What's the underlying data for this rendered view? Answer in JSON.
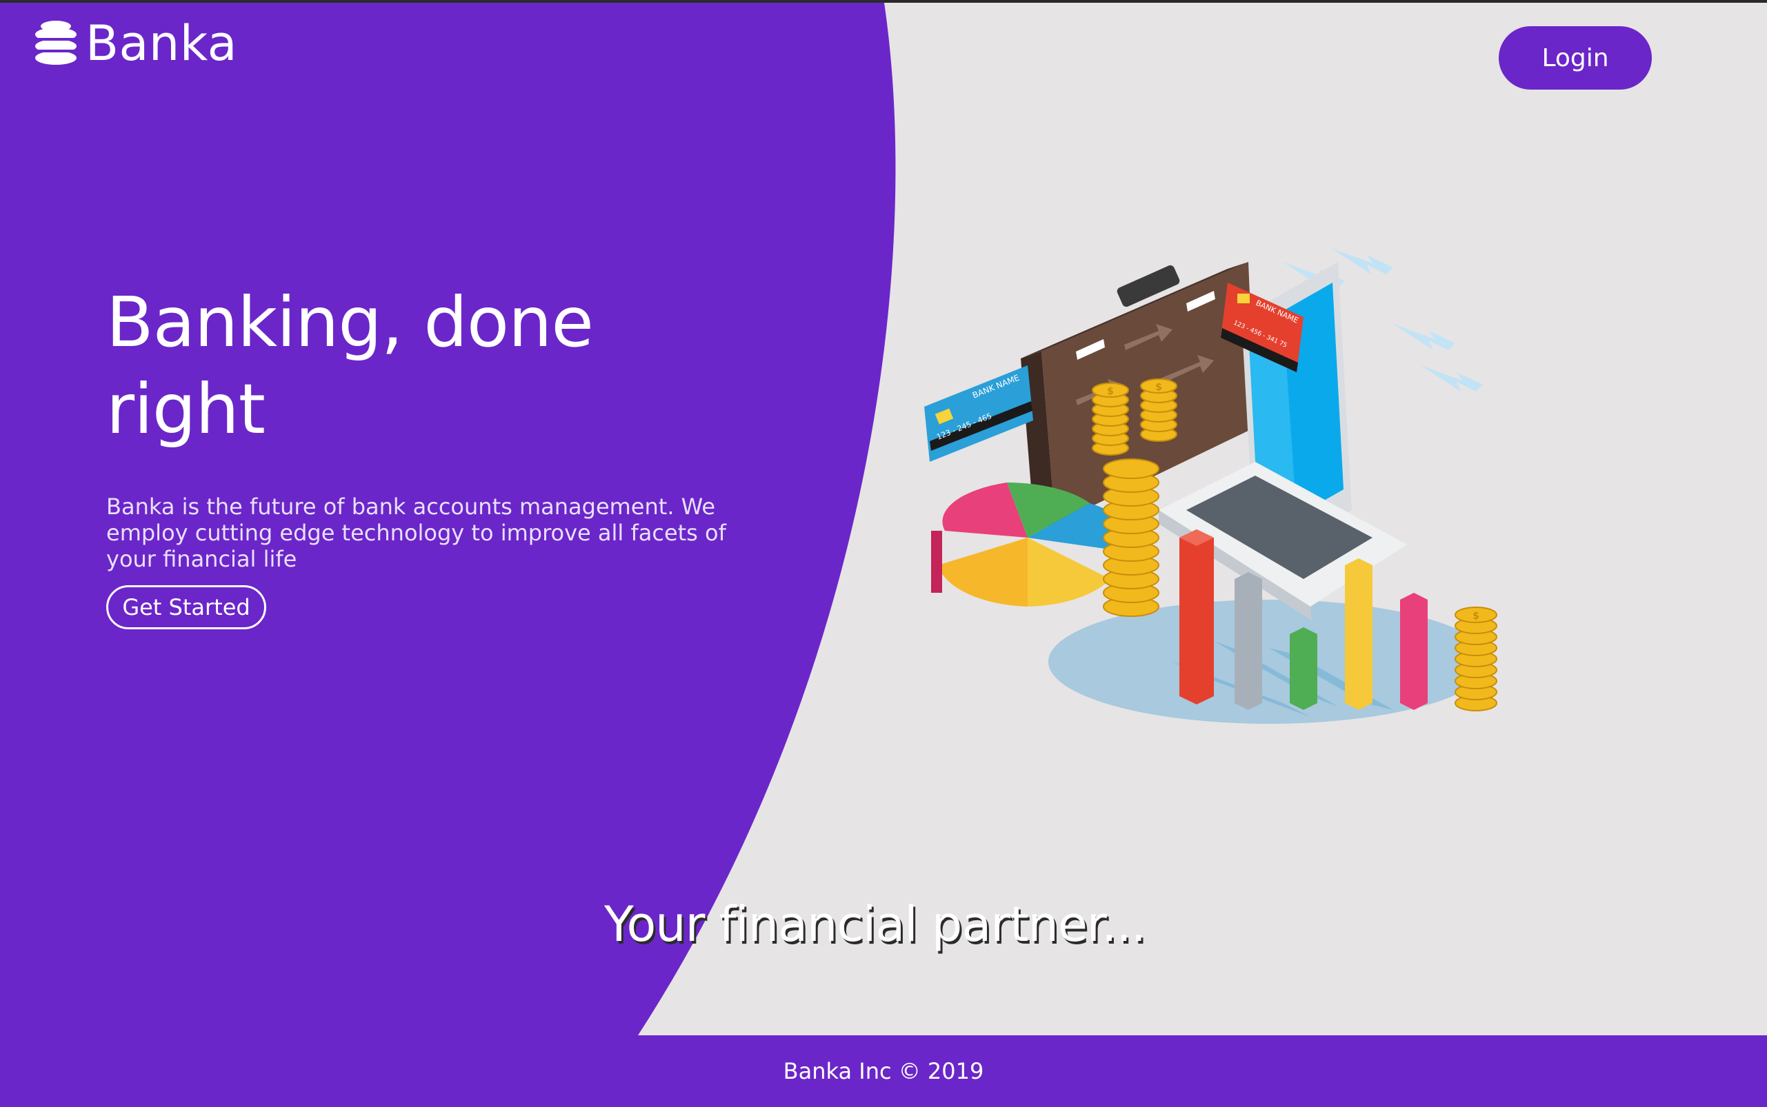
{
  "header": {
    "brand_name": "Banka",
    "login_label": "Login"
  },
  "hero": {
    "headline": "Banking, done right",
    "description": "Banka is the future of bank accounts management. We employ cutting edge technology to improve all facets of your financial life",
    "cta_label": "Get Started"
  },
  "illustration": {
    "card_left_name": "BANK NAME",
    "card_left_number": "123 - 245 - 465",
    "card_right_name": "BANK NAME",
    "card_right_number": "123 - 456 - 341 75",
    "coin_symbol": "$"
  },
  "tagline": "Your financial partner...",
  "footer": {
    "copyright": "Banka Inc © 2019"
  },
  "colors": {
    "brand_purple": "#6b26c9",
    "page_background": "#e6e4e5",
    "text_on_purple": "#ffffff"
  },
  "icons": {
    "brand": "stacked-coins-icon"
  }
}
